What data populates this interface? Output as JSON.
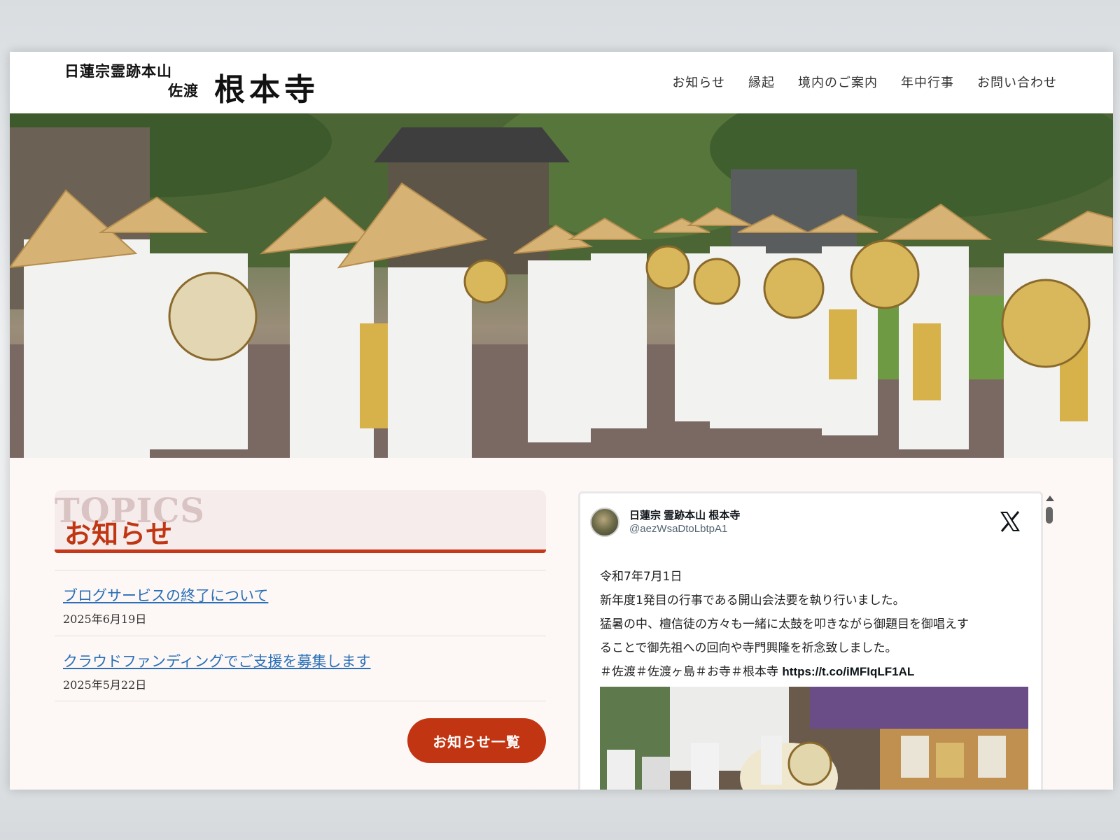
{
  "site": {
    "logo_line1": "日蓮宗霊跡本山",
    "logo_line2": "佐渡",
    "logo_name": "根本寺"
  },
  "nav": [
    {
      "label": "お知らせ"
    },
    {
      "label": "縁起"
    },
    {
      "label": "境内のご案内"
    },
    {
      "label": "年中行事"
    },
    {
      "label": "お問い合わせ"
    }
  ],
  "topics": {
    "bg_label": "TOPICS",
    "title": "お知らせ",
    "items": [
      {
        "title": "ブログサービスの終了について",
        "date": "2025年6月19日"
      },
      {
        "title": "クラウドファンディングでご支援を募集します",
        "date": "2025年5月22日"
      }
    ],
    "more_label": "お知らせ一覧"
  },
  "tweet": {
    "name": "日蓮宗 霊跡本山 根本寺",
    "handle": "@aezWsaDtoLbtpA1",
    "lines": [
      "令和7年7月1日",
      "新年度1発目の行事である開山会法要を執り行いました。",
      "猛暑の中、檀信徒の方々も一緒に太鼓を叩きながら御題目を御唱えす",
      "ることで御先祖への回向や寺門興隆を祈念致しました。",
      "＃佐渡＃佐渡ヶ島＃お寺＃根本寺"
    ],
    "link": "https://t.co/iMFIqLF1AL"
  },
  "colors": {
    "accent": "#c23512",
    "link": "#2a6fb7",
    "background": "#fdf8f6"
  }
}
